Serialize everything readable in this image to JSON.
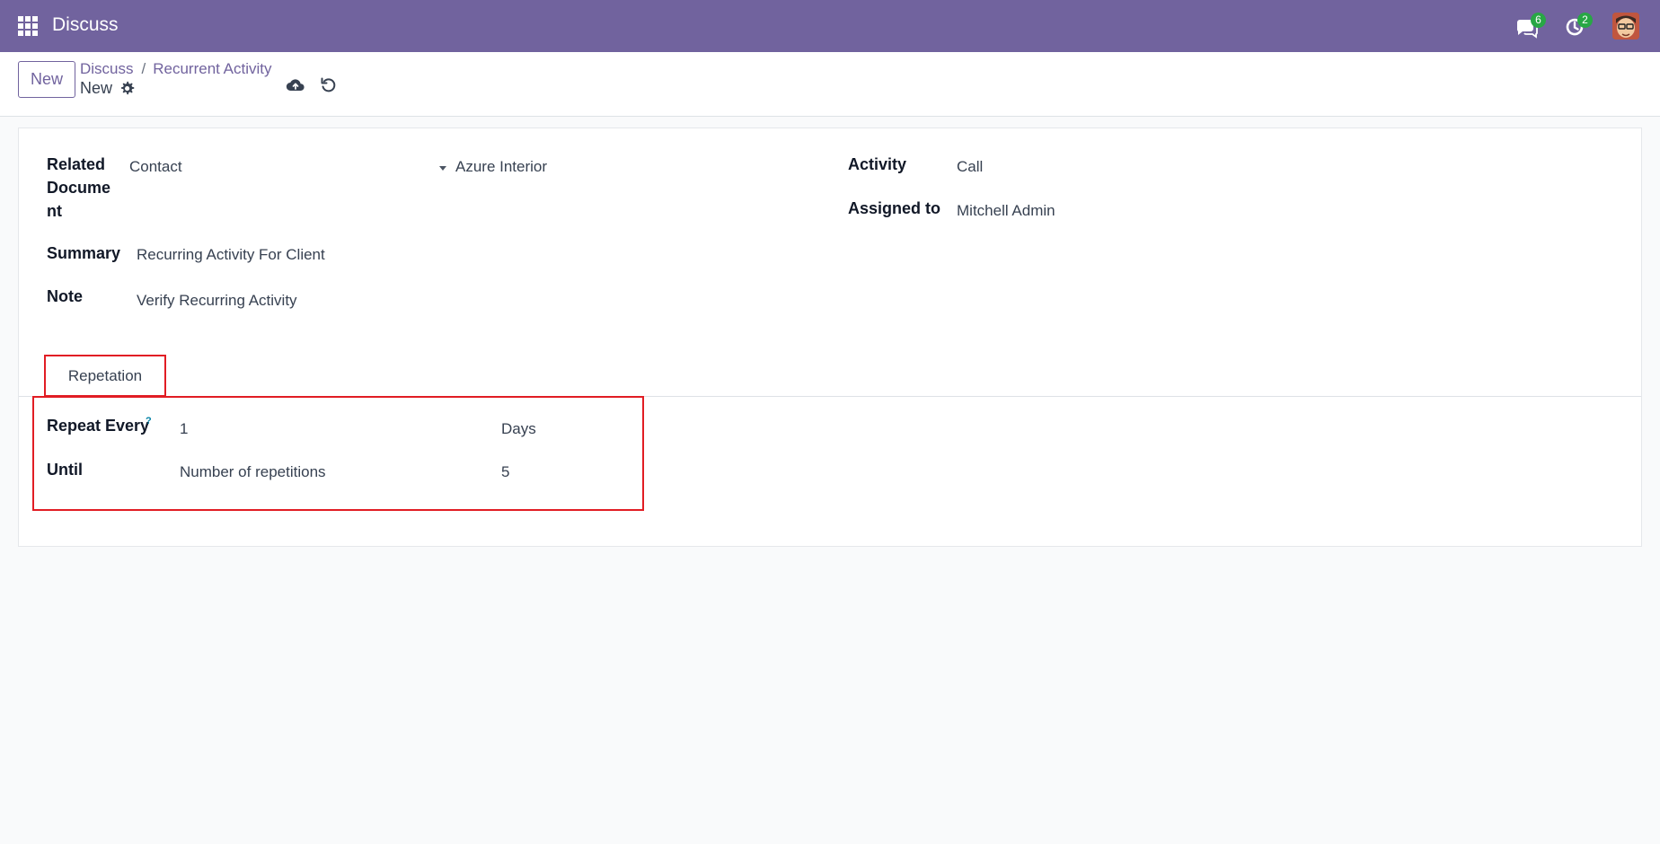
{
  "navbar": {
    "app_name": "Discuss",
    "icons": [
      "apps-grid-icon",
      "chat-icon",
      "activity-clock-icon",
      "user-avatar"
    ],
    "messages_count": "6",
    "activities_count": "2",
    "color": "#71639e"
  },
  "control_panel": {
    "new_button": "New",
    "breadcrumb": {
      "parent": "Discuss",
      "separator": "/",
      "current": "Recurrent Activity"
    },
    "record_title": "New",
    "icons": [
      "gear-icon",
      "cloud-upload-icon",
      "discard-icon"
    ]
  },
  "form": {
    "related_document": {
      "label_lines": [
        "Related",
        "Docume",
        "nt"
      ],
      "model": "Contact",
      "record": "Azure Interior"
    },
    "summary": {
      "label": "Summary",
      "value": "Recurring Activity For Client"
    },
    "note": {
      "label": "Note",
      "value": "Verify Recurring Activity"
    },
    "activity": {
      "label": "Activity",
      "value": "Call"
    },
    "assigned_to": {
      "label": "Assigned to",
      "value": "Mitchell Admin"
    }
  },
  "tabs": [
    {
      "label": "Repetation",
      "active": true
    }
  ],
  "repetition": {
    "repeat_every": {
      "label": "Repeat Every",
      "help": "?",
      "value": "1",
      "unit": "Days"
    },
    "until": {
      "label": "Until",
      "value": "Number of repetitions",
      "count": "5"
    }
  },
  "colors": {
    "brand": "#71639e",
    "badge": "#28a745",
    "highlight": "#e11d24"
  }
}
